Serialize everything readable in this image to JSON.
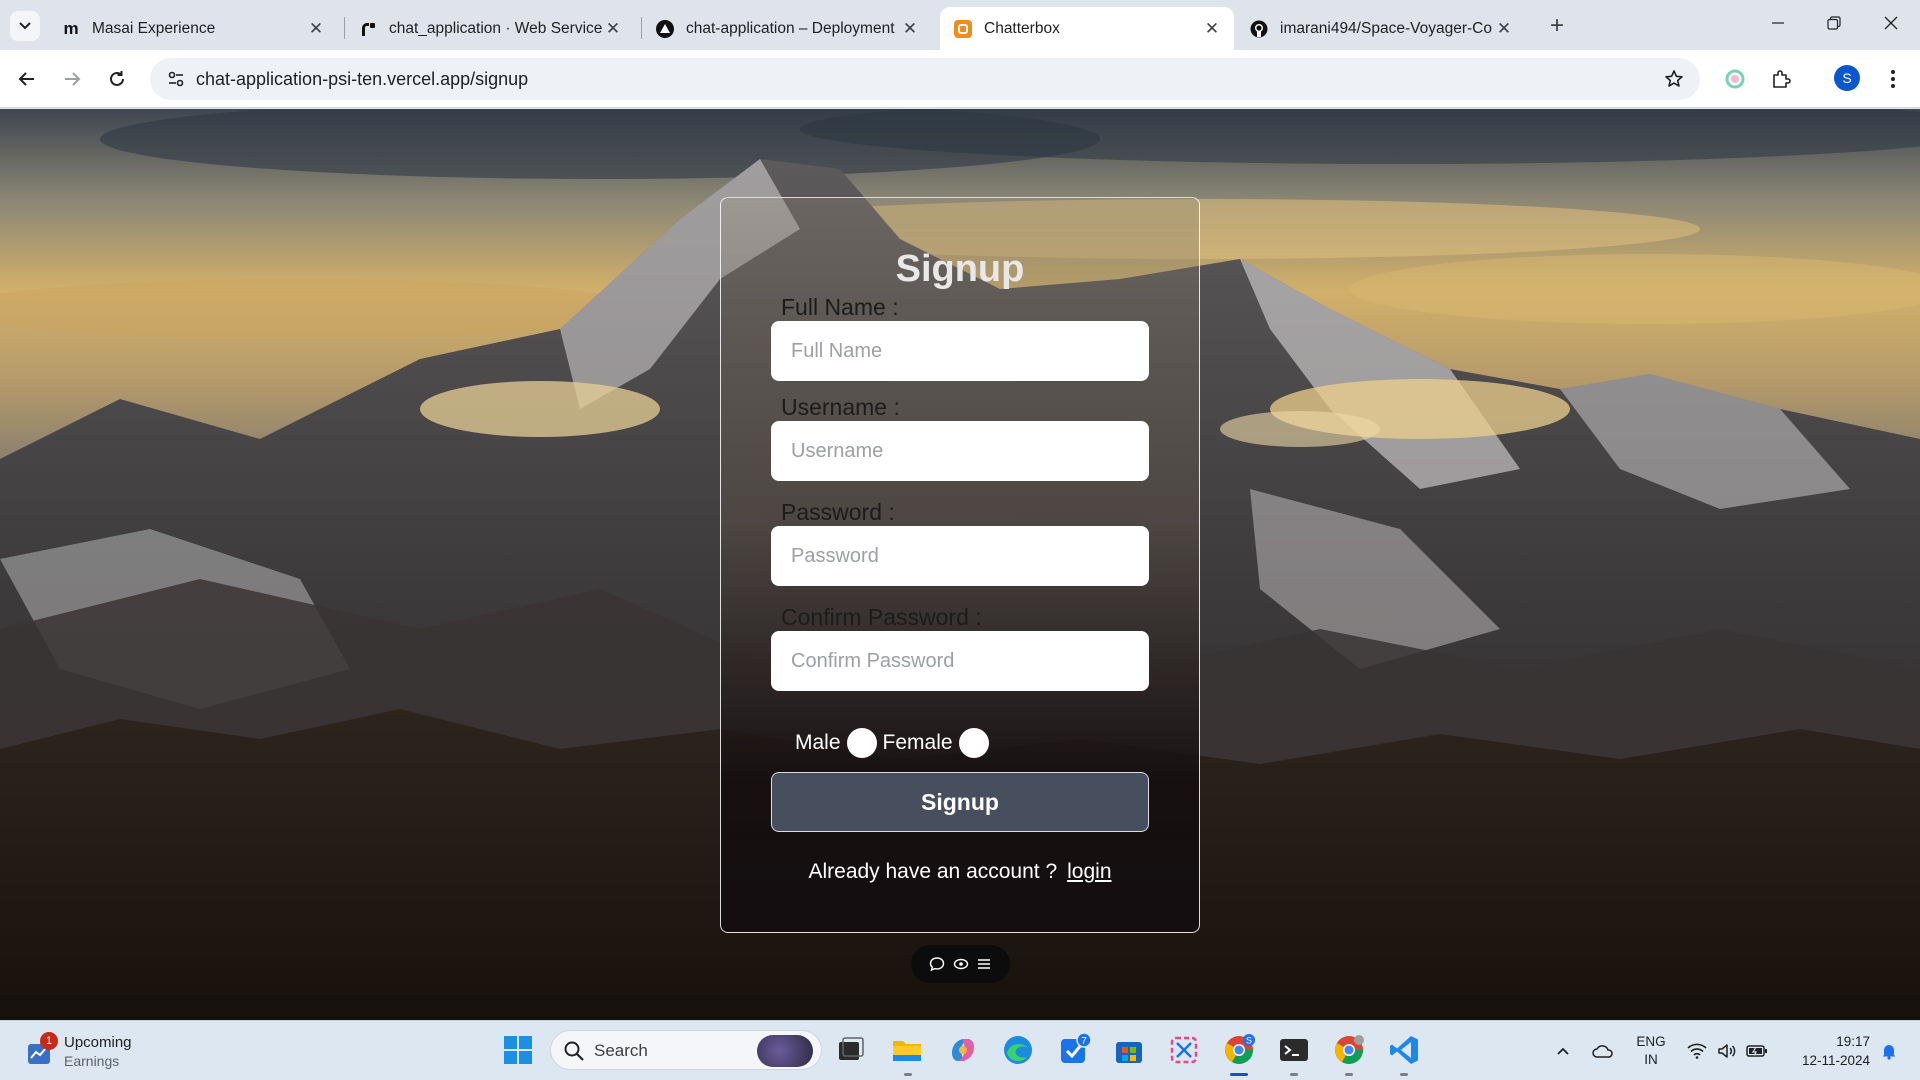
{
  "browser": {
    "tabs": [
      {
        "title": "Masai Experience",
        "favicon": "masai-icon",
        "active": false
      },
      {
        "title": "chat_application · Web Service",
        "favicon": "render-icon",
        "active": false
      },
      {
        "title": "chat-application – Deployment",
        "favicon": "vercel-icon",
        "active": false
      },
      {
        "title": "Chatterbox",
        "favicon": "chatterbox-icon",
        "active": true
      },
      {
        "title": "imarani494/Space-Voyager-Co",
        "favicon": "github-icon",
        "active": false
      }
    ],
    "url": "chat-application-psi-ten.vercel.app/signup",
    "profile_initial": "S"
  },
  "page": {
    "title": "Signup",
    "fields": [
      {
        "label": "Full Name :",
        "placeholder": "Full Name",
        "value": ""
      },
      {
        "label": "Username :",
        "placeholder": "Username",
        "value": ""
      },
      {
        "label": "Password :",
        "placeholder": "Password",
        "value": ""
      },
      {
        "label": "Confirm Password :",
        "placeholder": "Confirm Password",
        "value": ""
      }
    ],
    "gender": {
      "male": "Male",
      "female": "Female"
    },
    "submit_label": "Signup",
    "account_prompt": "Already have an account ?",
    "login_link": "login"
  },
  "taskbar": {
    "weather": {
      "title": "Upcoming",
      "subtitle": "Earnings",
      "badge": "1"
    },
    "search_label": "Search",
    "icons": [
      "windows-start-icon",
      "task-view-icon",
      "file-explorer-icon",
      "copilot-icon",
      "edge-icon",
      "todo-icon",
      "microsoft-store-icon",
      "snipping-tool-icon",
      "chrome-icon",
      "terminal-icon",
      "chrome-icon",
      "vscode-icon"
    ],
    "todo_badge": "7",
    "chrome_badge": "S",
    "lang": {
      "line1": "ENG",
      "line2": "IN"
    },
    "time": "19:17",
    "date": "12-11-2024"
  },
  "colors": {
    "accent": "#0b57d0",
    "signup_button": "#4c5668",
    "card_border": "#ffffff"
  }
}
